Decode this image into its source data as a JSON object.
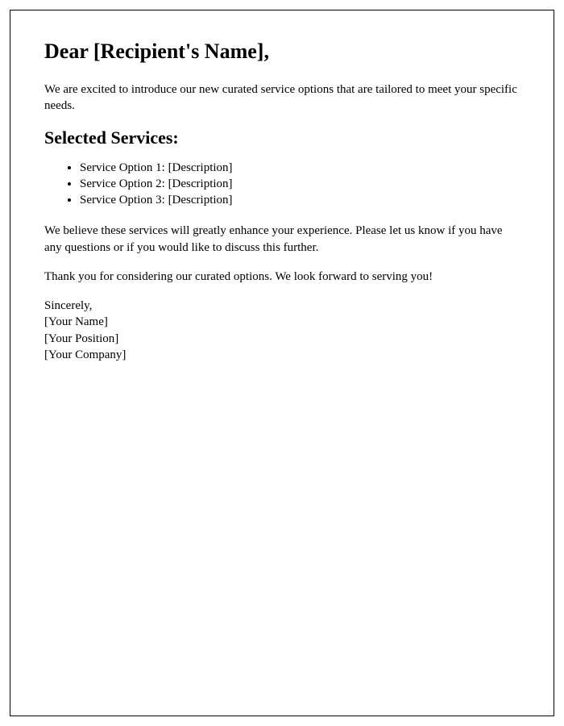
{
  "greeting": "Dear [Recipient's Name],",
  "intro": "We are excited to introduce our new curated service options that are tailored to meet your specific needs.",
  "section_heading": "Selected Services:",
  "services": [
    "Service Option 1: [Description]",
    "Service Option 2: [Description]",
    "Service Option 3: [Description]"
  ],
  "body_text": "We believe these services will greatly enhance your experience. Please let us know if you have any questions or if you would like to discuss this further.",
  "closing_line": "Thank you for considering our curated options. We look forward to serving you!",
  "signature": {
    "signoff": "Sincerely,",
    "name": "[Your Name]",
    "position": "[Your Position]",
    "company": "[Your Company]"
  }
}
